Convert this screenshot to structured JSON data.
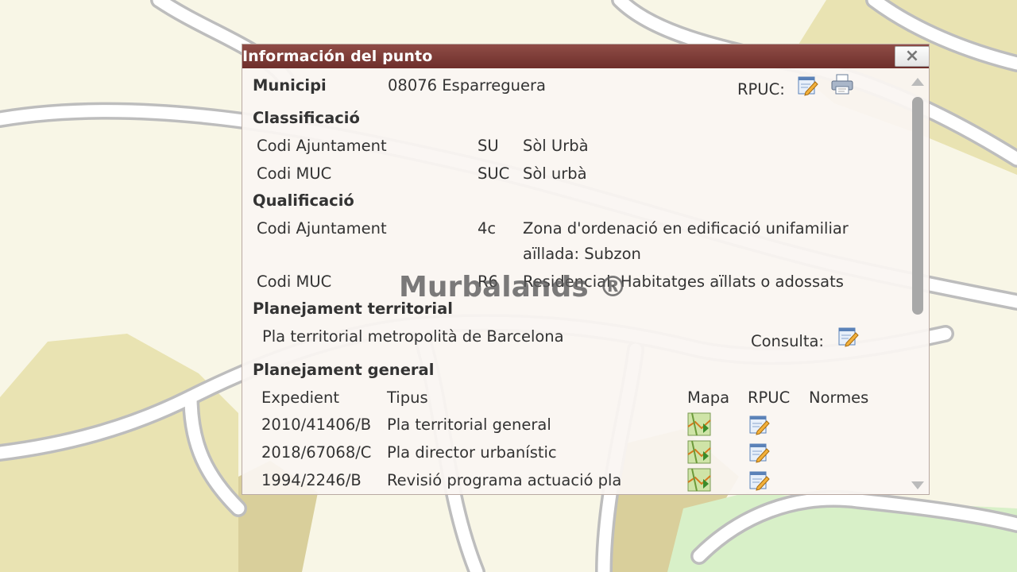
{
  "window": {
    "title": "Información del punto",
    "close_label": "×"
  },
  "municipi": {
    "label": "Municipi",
    "value": "08076 Esparreguera",
    "rpuc_label": "RPUC:"
  },
  "classificacio": {
    "heading": "Classificació",
    "rows": [
      {
        "label": "Codi Ajuntament",
        "code": "SU",
        "desc": "Sòl Urbà"
      },
      {
        "label": "Codi MUC",
        "code": "SUC",
        "desc": "Sòl urbà"
      }
    ]
  },
  "qualificacio": {
    "heading": "Qualificació",
    "rows": [
      {
        "label": "Codi Ajuntament",
        "code": "4c",
        "desc_line1": "Zona d'ordenació en edificació unifamiliar",
        "desc_line2": "aïllada: Subzon"
      },
      {
        "label": "Codi MUC",
        "code": "R6",
        "desc_line1": "Residencial. Habitatges aïllats o adossats"
      }
    ]
  },
  "territorial": {
    "heading": "Planejament territorial",
    "value": "Pla territorial metropolità de Barcelona",
    "consulta_label": "Consulta:"
  },
  "general": {
    "heading": "Planejament general",
    "columns": {
      "expedient": "Expedient",
      "tipus": "Tipus",
      "mapa": "Mapa",
      "rpuc": "RPUC",
      "normes": "Normes"
    },
    "rows": [
      {
        "expedient": "2010/41406/B",
        "tipus": "Pla territorial general"
      },
      {
        "expedient": "2018/67068/C",
        "tipus": "Pla director urbanístic"
      },
      {
        "expedient": "1994/2246/B",
        "tipus": "Revisió programa actuació pla"
      }
    ]
  },
  "watermark": "Murbalands ®",
  "colors": {
    "title_bar": "#7a3a35",
    "map_background": "#f8f6e6",
    "road_fill": "#ffffff",
    "road_casing": "#bdbdbd"
  }
}
